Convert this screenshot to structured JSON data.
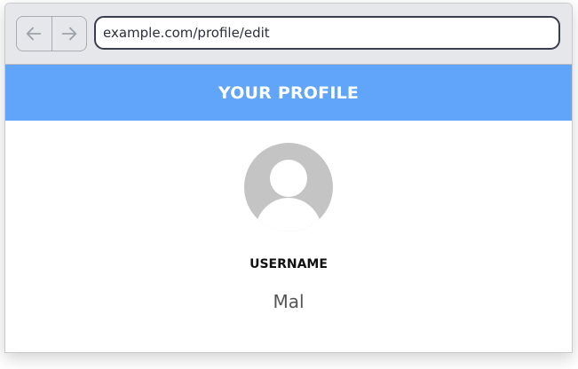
{
  "browser": {
    "url": "example.com/profile/edit",
    "back_icon": "arrow-left-icon",
    "forward_icon": "arrow-right-icon"
  },
  "page": {
    "title": "YOUR PROFILE",
    "accent_color": "#60a5fa",
    "avatar_icon": "user-avatar-icon",
    "username_label": "USERNAME",
    "username_value": "Mal"
  }
}
